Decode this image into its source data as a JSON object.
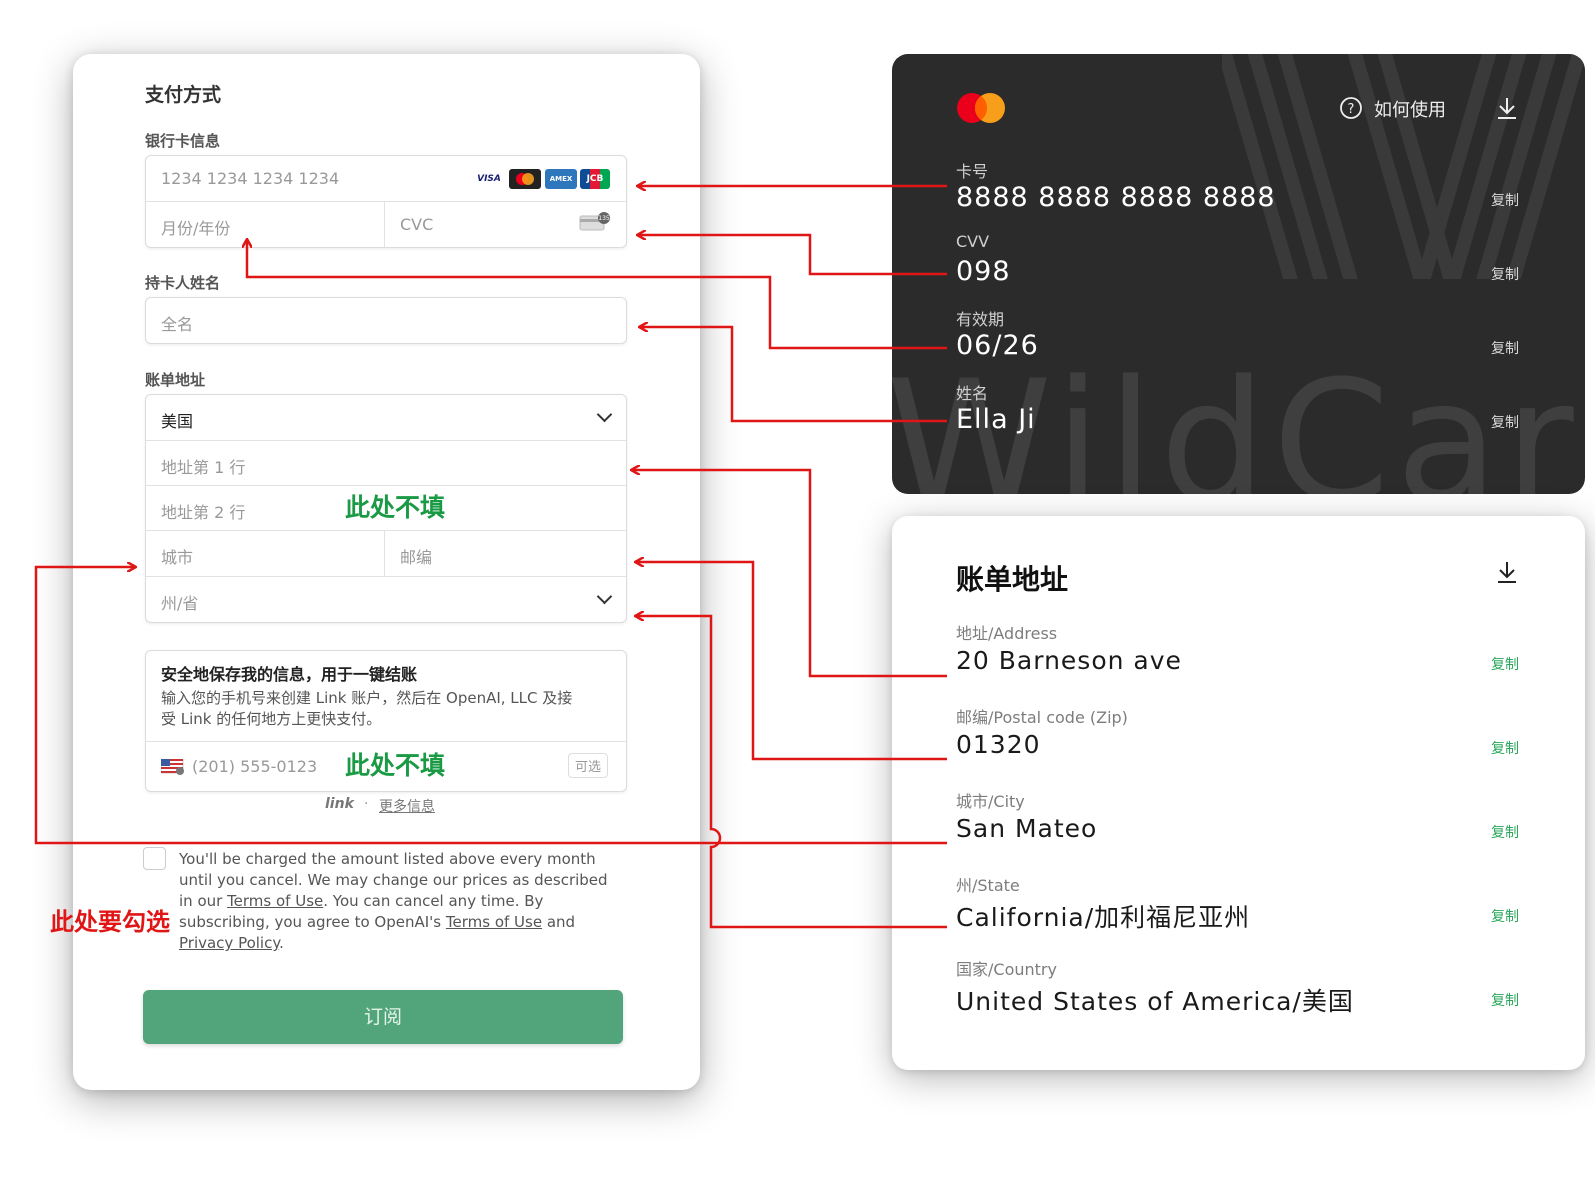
{
  "payment_form": {
    "title": "支付方式",
    "card_section_label": "银行卡信息",
    "card_number_placeholder": "1234 1234 1234 1234",
    "card_brands": [
      "VISA",
      "Mastercard",
      "AMEX",
      "JCB"
    ],
    "expiry_placeholder": "月份/年份",
    "cvc_placeholder": "CVC",
    "holder_section_label": "持卡人姓名",
    "holder_placeholder": "全名",
    "billing_section_label": "账单地址",
    "country_value": "美国",
    "address1_placeholder": "地址第 1 行",
    "address2_placeholder": "地址第 2 行",
    "city_placeholder": "城市",
    "zip_placeholder": "邮编",
    "state_placeholder": "州/省",
    "link_title": "安全地保存我的信息，用于一键结账",
    "link_desc_line1": "输入您的手机号来创建 Link 账户，然后在 OpenAI, LLC 及接",
    "link_desc_line2": "受 Link 的任何地方上更快支付。",
    "phone_placeholder": "(201) 555-0123",
    "optional_badge": "可选",
    "link_logo": "link",
    "link_dot": "·",
    "link_more": "更多信息",
    "terms": {
      "line1": "You'll be charged the amount listed above every month",
      "line2": "until you cancel. We may change our prices as described",
      "line3_pre": "in our ",
      "terms_link": "Terms of Use",
      "line3_post": ". You can cancel any time. By",
      "line4_pre": "subscribing, you agree to OpenAI's ",
      "line4_post": " and",
      "privacy_link": "Privacy Policy",
      "period": "."
    },
    "subscribe_label": "订阅"
  },
  "annotations": {
    "skip_note_1": "此处不填",
    "skip_note_2": "此处不填",
    "check_note": "此处要勾选"
  },
  "card_panel": {
    "help_label": "如何使用",
    "watermark": "WildCard",
    "fields": [
      {
        "label": "卡号",
        "value": "8888 8888 8888 8888",
        "copy": "复制"
      },
      {
        "label": "CVV",
        "value": "098",
        "copy": "复制"
      },
      {
        "label": "有效期",
        "value": "06/26",
        "copy": "复制"
      },
      {
        "label": "姓名",
        "value": "Ella Ji",
        "copy": "复制"
      }
    ]
  },
  "address_panel": {
    "title": "账单地址",
    "fields": [
      {
        "label": "地址/Address",
        "value": "20 Barneson ave",
        "copy": "复制"
      },
      {
        "label": "邮编/Postal code (Zip)",
        "value": "01320",
        "copy": "复制"
      },
      {
        "label": "城市/City",
        "value": "San Mateo",
        "copy": "复制"
      },
      {
        "label": "州/State",
        "value": "California/加利福尼亚州",
        "copy": "复制"
      },
      {
        "label": "国家/Country",
        "value": "United States of America/美国",
        "copy": "复制"
      }
    ]
  },
  "colors": {
    "arrow": "#e01616",
    "note_green": "#1a9a45",
    "subscribe_bg": "#52a57a",
    "card_bg": "#2b2b2b",
    "copy_green": "#2aa65a"
  }
}
